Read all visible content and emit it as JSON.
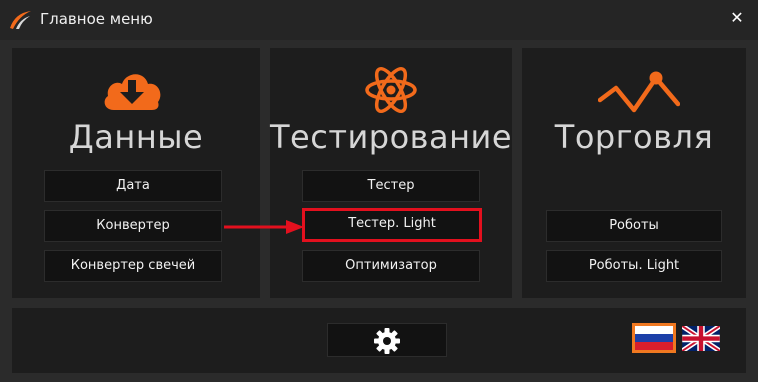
{
  "window": {
    "title": "Главное меню",
    "close_glyph": "✕",
    "logo_icon": "app-logo-icon"
  },
  "accent_color": "#f26a1b",
  "highlight_color": "#e3101e",
  "sections": {
    "data": {
      "icon": "download-cloud-icon",
      "heading": "Данные",
      "buttons": [
        "Дата",
        "Конвертер",
        "Конвертер свечей"
      ]
    },
    "testing": {
      "icon": "atom-icon",
      "heading": "Тестирование",
      "buttons": [
        "Тестер",
        "Тестер. Light",
        "Оптимизатор"
      ],
      "highlighted_button": "Тестер. Light"
    },
    "trading": {
      "icon": "trend-line-icon",
      "heading": "Торговля",
      "buttons": [
        "Роботы",
        "Роботы. Light"
      ]
    }
  },
  "footer": {
    "settings_icon": "gear-icon",
    "languages": [
      "Русский",
      "English"
    ],
    "selected_language": "Русский"
  },
  "annotation": {
    "arrow_color": "#e3101e"
  }
}
